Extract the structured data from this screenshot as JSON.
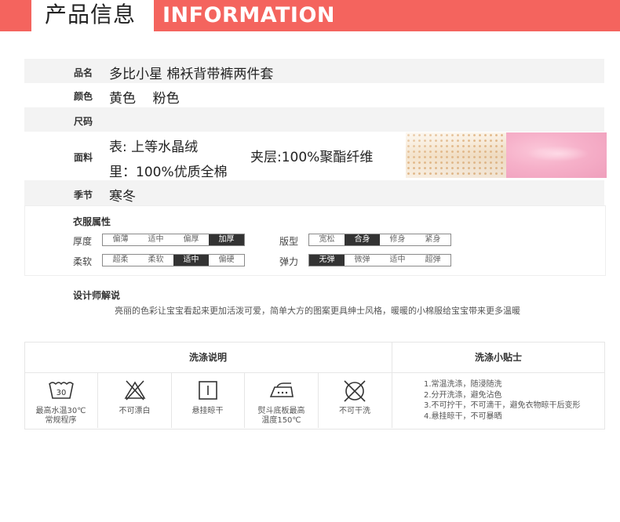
{
  "header": {
    "title_cn": "产品信息",
    "title_en": "INFORMATION"
  },
  "info": {
    "name_label": "品名",
    "name_value": "多比小星  棉袄背带裤两件套",
    "color_label": "颜色",
    "color_value": "黄色    粉色",
    "size_label": "尺码",
    "fabric_label": "面料",
    "fabric_outer": "表: 上等水晶绒",
    "fabric_inner": "里：100%优质全棉",
    "fabric_middle": "夹层:100%聚酯纤维",
    "season_label": "季节",
    "season_value": "寒冬"
  },
  "attributes": {
    "title": "衣服属性",
    "thickness": {
      "label": "厚度",
      "options": [
        "偏薄",
        "适中",
        "偏厚",
        "加厚"
      ],
      "selected": "加厚"
    },
    "fit": {
      "label": "版型",
      "options": [
        "宽松",
        "合身",
        "修身",
        "紧身"
      ],
      "selected": "合身"
    },
    "softness": {
      "label": "柔软",
      "options": [
        "超柔",
        "柔软",
        "适中",
        "偏硬"
      ],
      "selected": "适中"
    },
    "elasticity": {
      "label": "弹力",
      "options": [
        "无弹",
        "微弹",
        "适中",
        "超弹"
      ],
      "selected": "无弹"
    }
  },
  "designer": {
    "title": "设计师解说",
    "text": "亮丽的色彩让宝宝看起来更加活泼可爱，简单大方的图案更具绅士风格，暖暖的小棉服给宝宝带来更多温暖"
  },
  "washing": {
    "title": "洗涤说明",
    "items": [
      {
        "icon": "wash-30-icon",
        "line1": "最高水温30℃",
        "line2": "常规程序"
      },
      {
        "icon": "no-bleach-icon",
        "line1": "不可漂白",
        "line2": ""
      },
      {
        "icon": "hang-dry-icon",
        "line1": "悬挂晾干",
        "line2": ""
      },
      {
        "icon": "iron-150-icon",
        "line1": "熨斗底板最高",
        "line2": "温度150℃"
      },
      {
        "icon": "no-dry-clean-icon",
        "line1": "不可干洗",
        "line2": ""
      }
    ]
  },
  "tips": {
    "title": "洗涤小贴士",
    "lines": [
      "1.常温洗涤，随浸随洗",
      "2.分开洗涤，避免沾色",
      "3.不可拧干，不可滴干，避免衣物晾干后变形",
      "4.悬挂晾干，不可暴晒"
    ]
  },
  "colors": {
    "banner": "#f4645e",
    "row_gray": "#f3f3f3",
    "selected_option": "#333333"
  }
}
